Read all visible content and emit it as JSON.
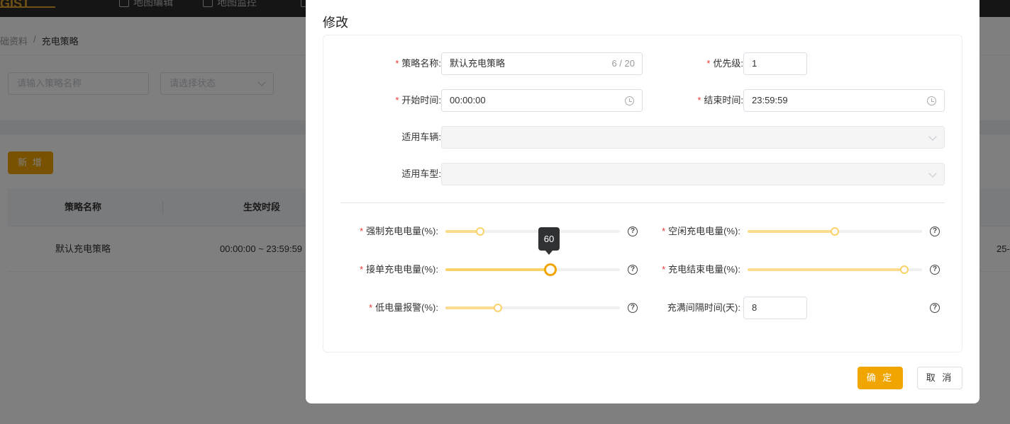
{
  "background": {
    "nav": [
      {
        "label": "地图编辑",
        "icon": "map-pin-icon"
      },
      {
        "label": "地图监控",
        "icon": "chart-icon"
      }
    ],
    "breadcrumb": {
      "parent": "础资料",
      "separator": "/",
      "current": "充电策略"
    },
    "filters": {
      "name_placeholder": "请输入策略名称",
      "status_placeholder": "请选择状态"
    },
    "add_button": "新 增",
    "table": {
      "headers": [
        "策略名称",
        "生效时段"
      ],
      "rows": [
        {
          "name": "默认充电策略",
          "period": "00:00:00 ~ 23:59:59",
          "extra": "25-"
        }
      ]
    }
  },
  "dialog": {
    "title": "修改",
    "fields": {
      "strategy_name": {
        "label": "策略名称:",
        "value": "默认充电策略",
        "count": "6 / 20",
        "required": true
      },
      "priority": {
        "label": "优先级:",
        "value": "1",
        "required": true
      },
      "start_time": {
        "label": "开始时间:",
        "value": "00:00:00",
        "required": true
      },
      "end_time": {
        "label": "结束时间:",
        "value": "23:59:59",
        "required": true
      },
      "vehicles": {
        "label": "适用车辆:",
        "value": ""
      },
      "vehicle_types": {
        "label": "适用车型:",
        "value": ""
      }
    },
    "sliders": {
      "force_charge": {
        "label": "强制充电电量(%):",
        "value": 20,
        "required": true
      },
      "idle_charge": {
        "label": "空闲充电电量(%):",
        "value": 50,
        "required": true
      },
      "order_charge": {
        "label": "接单充电电量(%):",
        "value": 60,
        "required": true,
        "tooltip": "60"
      },
      "charge_end": {
        "label": "充电结束电量(%):",
        "value": 90,
        "required": true
      },
      "low_battery_alarm": {
        "label": "低电量报警(%):",
        "value": 30,
        "required": true
      }
    },
    "full_interval": {
      "label": "充满间隔时间(天):",
      "value": "8"
    },
    "help_glyph": "?",
    "buttons": {
      "ok": "确 定",
      "cancel": "取 消"
    },
    "colors": {
      "primary": "#f0a500",
      "slider_fill": "#fbdc8e",
      "required": "#e53935"
    }
  }
}
